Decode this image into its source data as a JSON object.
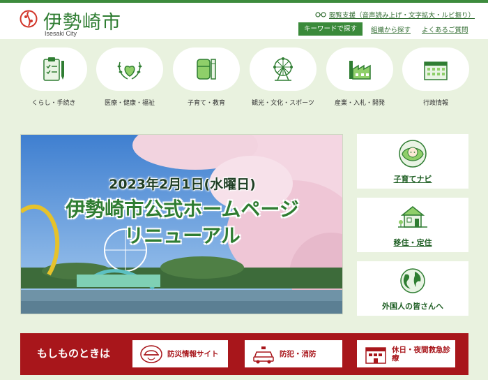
{
  "header": {
    "logo_text": "伊勢崎市",
    "logo_sub": "Isesaki City",
    "assist_link": "閲覧支援（音声読み上げ・文字拡大・ルビ振り）",
    "keyword_button": "キーワードで探す",
    "org_link": "組織から探す",
    "faq_link": "よくあるご質問"
  },
  "categories": [
    {
      "label": "くらし・手続き",
      "icon": "clipboard-icon"
    },
    {
      "label": "医療・健康・福祉",
      "icon": "heart-wreath-icon"
    },
    {
      "label": "子育て・教育",
      "icon": "school-bag-icon"
    },
    {
      "label": "観光・文化・スポーツ",
      "icon": "ferris-wheel-icon"
    },
    {
      "label": "産業・入札・開発",
      "icon": "factory-icon"
    },
    {
      "label": "行政情報",
      "icon": "city-hall-icon"
    }
  ],
  "hero": {
    "date": "2023年2月1日(水曜日)",
    "title_line1": "伊勢崎市公式ホームページ",
    "title_line2": "リニューアル"
  },
  "side_cards": [
    {
      "label": "子育てナビ",
      "icon": "baby-icon"
    },
    {
      "label": "移住・定住",
      "icon": "house-icon"
    },
    {
      "label": "外国人の皆さんへ",
      "icon": "globe-icon"
    }
  ],
  "emergency": {
    "title": "もしものときは",
    "buttons": [
      {
        "label": "防災情報サイト",
        "icon": "disaster-helmet-icon"
      },
      {
        "label": "防犯・消防",
        "icon": "police-car-icon"
      },
      {
        "label": "休日・夜間救急診療",
        "icon": "hospital-icon"
      }
    ]
  },
  "colors": {
    "brand_green": "#2f7d32",
    "page_background": "#e9f2df",
    "emergency_red": "#a8161b"
  }
}
